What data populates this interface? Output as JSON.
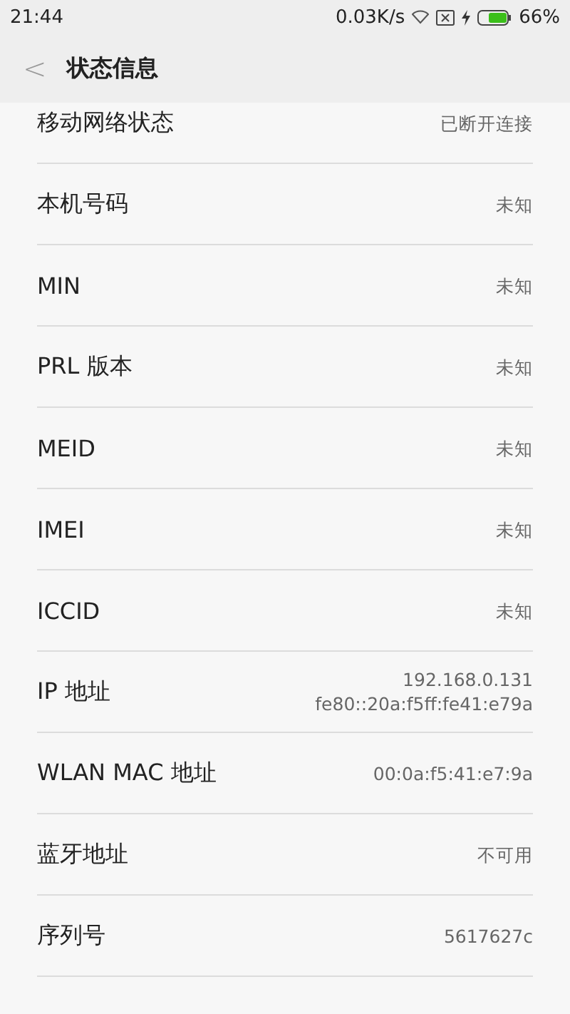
{
  "status_bar": {
    "time": "21:44",
    "speed": "0.03K/s",
    "battery": "66%"
  },
  "header": {
    "back": "<",
    "title": "状态信息"
  },
  "rows": [
    {
      "label": "移动网络状态",
      "values": [
        "已断开连接"
      ]
    },
    {
      "label": "本机号码",
      "values": [
        "未知"
      ]
    },
    {
      "label": "MIN",
      "values": [
        "未知"
      ]
    },
    {
      "label": "PRL 版本",
      "values": [
        "未知"
      ]
    },
    {
      "label": "MEID",
      "values": [
        "未知"
      ]
    },
    {
      "label": "IMEI",
      "values": [
        "未知"
      ]
    },
    {
      "label": "ICCID",
      "values": [
        "未知"
      ]
    },
    {
      "label": "IP 地址",
      "values": [
        "192.168.0.131",
        "fe80::20a:f5ff:fe41:e79a"
      ]
    },
    {
      "label": "WLAN MAC 地址",
      "values": [
        "00:0a:f5:41:e7:9a"
      ]
    },
    {
      "label": "蓝牙地址",
      "values": [
        "不可用"
      ]
    },
    {
      "label": "序列号",
      "values": [
        "5617627c"
      ]
    }
  ]
}
